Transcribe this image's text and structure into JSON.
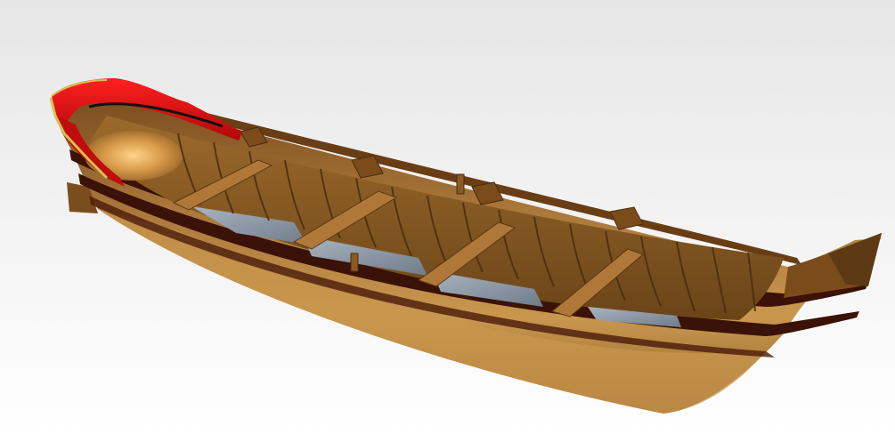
{
  "scene": {
    "subject": "boat-3d-model",
    "colors": {
      "background_top": "#e6e6e6",
      "background_bottom": "#ffffff",
      "hull_light": "#c49148",
      "hull_mid": "#9a6a2e",
      "hull_dark": "#5e3a14",
      "wale_stripe": "#3a1208",
      "gunwale_red": "#e00a0a",
      "gunwale_red_dark": "#8c0606",
      "interior": "#8a5a22",
      "interior_dark": "#5a3812",
      "floor": "#8c99a8",
      "thwart": "#b07838",
      "gold_trim": "#d8c050"
    }
  }
}
